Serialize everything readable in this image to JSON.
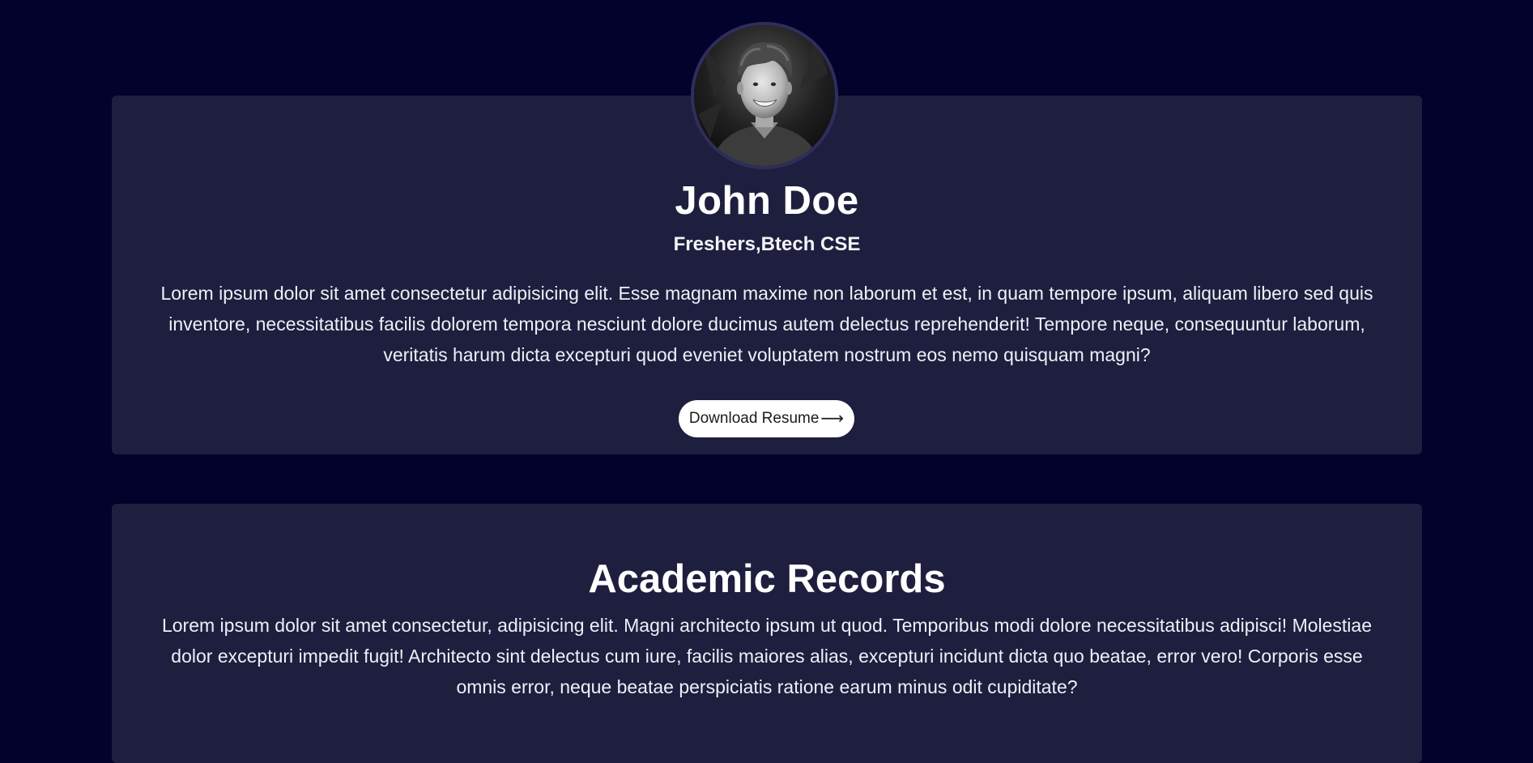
{
  "profile": {
    "name": "John Doe",
    "subtitle": "Freshers,Btech CSE",
    "bio": "Lorem ipsum dolor sit amet consectetur adipisicing elit. Esse magnam maxime non laborum et est, in quam tempore ipsum, aliquam libero sed quis inventore, necessitatibus facilis dolorem tempora nesciunt dolore ducimus autem delectus reprehenderit! Tempore neque, consequuntur laborum, veritatis harum dicta excepturi quod eveniet voluptatem nostrum eos nemo quisquam magni?",
    "resume_button_label": "Download Resume",
    "resume_button_icon": "arrow-right-icon",
    "avatar_icon": "profile-photo"
  },
  "academic": {
    "title": "Academic Records",
    "text": "Lorem ipsum dolor sit amet consectetur, adipisicing elit. Magni architecto ipsum ut quod. Temporibus modi dolore necessitatibus adipisci! Molestiae dolor excepturi impedit fugit! Architecto sint delectus cum iure, facilis maiores alias, excepturi incidunt dicta quo beatae, error vero! Corporis esse omnis error, neque beatae perspiciatis ratione earum minus odit cupiditate?"
  },
  "colors": {
    "page_background": "#03022c",
    "card_background": "#1e1f3e",
    "avatar_border": "#2f2d5c",
    "button_background": "#ffffff",
    "text": "#ffffff"
  }
}
